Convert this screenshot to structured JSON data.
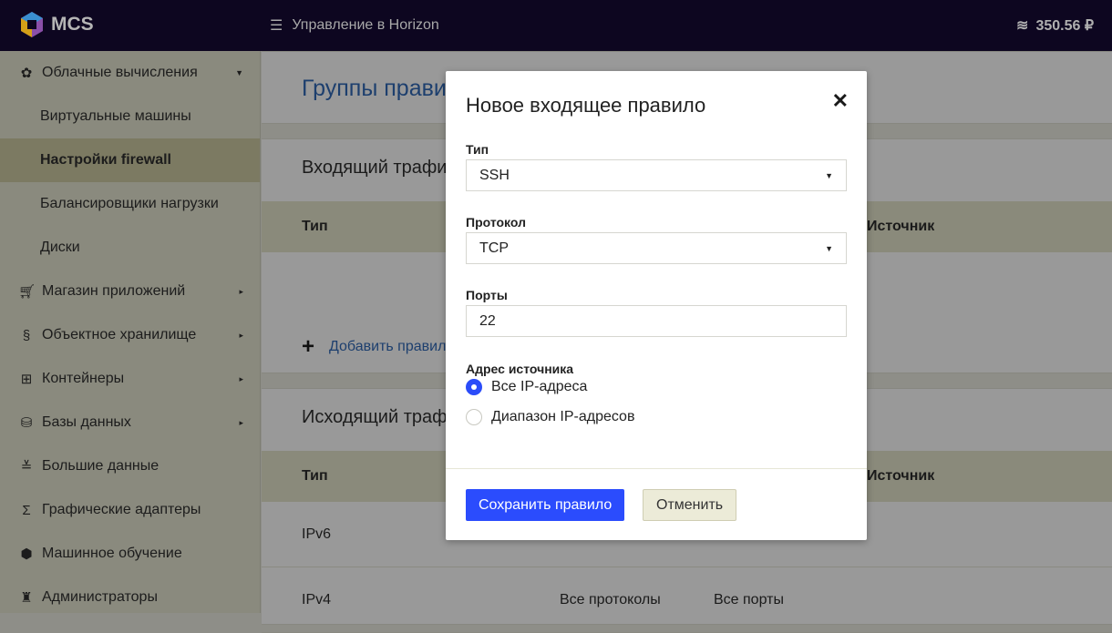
{
  "header": {
    "brand": "MCS",
    "horizon": "Управление в Horizon",
    "balance": "350.56 ₽"
  },
  "sidebar": {
    "items": [
      {
        "label": "Облачные вычисления",
        "icon": "cloud-compute-icon",
        "sub": false,
        "arrow": "▼"
      },
      {
        "label": "Виртуальные машины",
        "sub": true
      },
      {
        "label": "Настройки firewall",
        "sub": true,
        "active": true
      },
      {
        "label": "Балансировщики нагрузки",
        "sub": true
      },
      {
        "label": "Диски",
        "sub": true
      },
      {
        "label": "Магазин приложений",
        "icon": "cart-icon",
        "arrow": "▸"
      },
      {
        "label": "Объектное хранилище",
        "icon": "storage-icon",
        "arrow": "▸"
      },
      {
        "label": "Контейнеры",
        "icon": "containers-icon",
        "arrow": "▸"
      },
      {
        "label": "Базы данных",
        "icon": "database-icon",
        "arrow": "▸"
      },
      {
        "label": "Большие данные",
        "icon": "bigdata-icon"
      },
      {
        "label": "Графические адаптеры",
        "icon": "sigma-icon"
      },
      {
        "label": "Машинное обучение",
        "icon": "ml-icon"
      },
      {
        "label": "Администраторы",
        "icon": "admins-icon"
      }
    ]
  },
  "main": {
    "title": "Группы правил",
    "incoming": {
      "title": "Входящий трафик",
      "col_type": "Тип",
      "col_source": "Источник",
      "add": "Добавить правило"
    },
    "outgoing": {
      "title": "Исходящий трафик",
      "col_type": "Тип",
      "col_source": "Источник",
      "rows": [
        {
          "type": "IPv6",
          "proto": "",
          "ports": ""
        },
        {
          "type": "IPv4",
          "proto": "Все протоколы",
          "ports": "Все порты"
        }
      ]
    }
  },
  "modal": {
    "title": "Новое входящее правило",
    "type_label": "Тип",
    "type_value": "SSH",
    "proto_label": "Протокол",
    "proto_value": "TCP",
    "ports_label": "Порты",
    "ports_value": "22",
    "source_label": "Адрес источника",
    "opt_all": "Все IP-адреса",
    "opt_range": "Диапазон IP-адресов",
    "save": "Сохранить правило",
    "cancel": "Отменить"
  },
  "colors": {
    "accent": "#2b4cfd",
    "header": "#0d0620"
  }
}
